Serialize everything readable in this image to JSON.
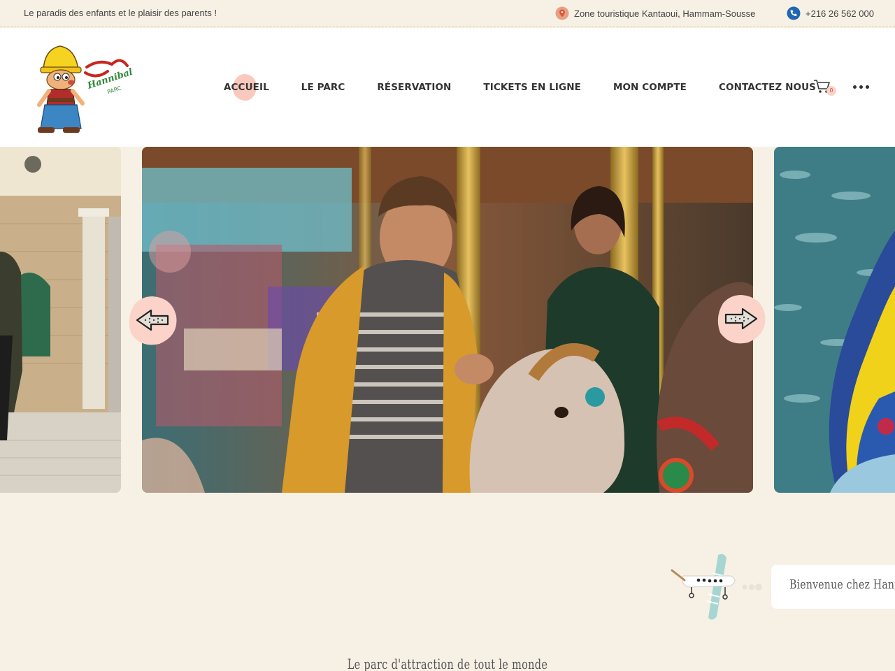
{
  "topbar": {
    "tagline": "Le paradis des enfants et le plaisir des parents !",
    "address": "Zone touristique Kantaoui, Hammam-Sousse",
    "phone": "+216 26 562 000",
    "address_icon": "map-pin-icon",
    "phone_icon": "phone-icon"
  },
  "header": {
    "logo_text": "Hannibal Park",
    "nav": [
      {
        "label": "ACCUEIL",
        "active": true
      },
      {
        "label": "LE PARC",
        "active": false
      },
      {
        "label": "RÉSERVATION",
        "active": false
      },
      {
        "label": "TICKETS EN LIGNE",
        "active": false
      },
      {
        "label": "MON COMPTE",
        "active": false
      },
      {
        "label": "CONTACTEZ NOUS",
        "active": false
      }
    ],
    "cart_count": "0"
  },
  "carousel": {
    "prev_icon": "arrow-left-icon",
    "next_icon": "arrow-right-icon"
  },
  "welcome": {
    "text": "Bienvenue chez Hannibal Park"
  },
  "subtitle": "Le parc d'attraction de tout le monde",
  "colors": {
    "accent_blob": "#f9c9bd",
    "background": "#f7f0e5"
  }
}
